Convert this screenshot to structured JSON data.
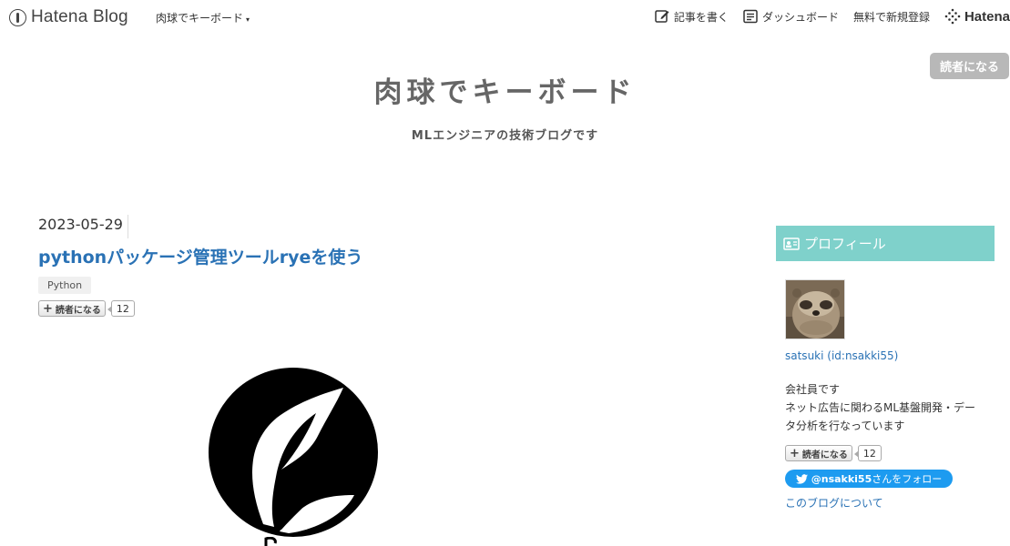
{
  "navbar": {
    "logo_text": "Hatena Blog",
    "blog_name": "肉球でキーボード",
    "caret": "▾",
    "write_label": "記事を書く",
    "dashboard_label": "ダッシュボード",
    "signup_label": "無料で新規登録",
    "hatena_label": "Hatena"
  },
  "reader_button_top": "読者になる",
  "header": {
    "title": "肉球でキーボード",
    "description": "MLエンジニアの技術ブログです"
  },
  "entry": {
    "date": "2023-05-29",
    "title": "pythonパッケージ管理ツールryeを使う",
    "category": "Python",
    "subscribe_label": "読者になる",
    "subscribe_plus": "+",
    "subscriber_count": "12"
  },
  "sidebar": {
    "heading": "プロフィール",
    "profile_name": "satsuki (id:nsakki55)",
    "profile_desc_line1": "会社員です",
    "profile_desc_line2": "ネット広告に関わるML基盤開発・デー",
    "profile_desc_line3": "タ分析を行なっています",
    "subscribe_label": "読者になる",
    "subscribe_plus": "+",
    "subscriber_count": "12",
    "twitter_handle": "@nsakki55",
    "twitter_suffix": "さんをフォロー",
    "about_link": "このブログについて"
  },
  "colors": {
    "link": "#2a72b5",
    "sidebar_heading_bg": "#7fd1cb",
    "twitter": "#1d9bf0"
  }
}
